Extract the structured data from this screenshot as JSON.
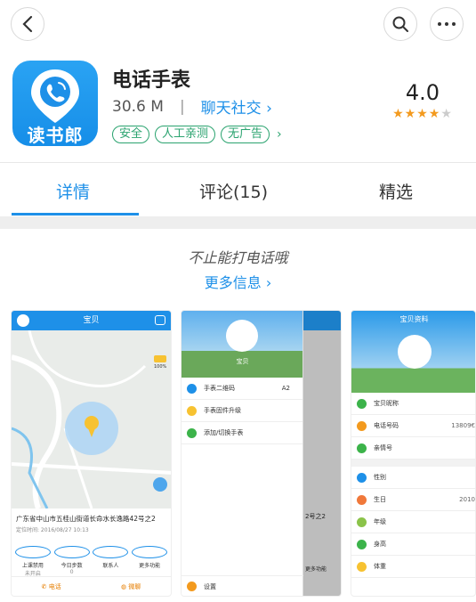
{
  "app": {
    "name": "电话手表",
    "size": "30.6 M",
    "separator": "|",
    "category": "聊天社交",
    "tags": [
      "安全",
      "人工亲测",
      "无广告"
    ],
    "rating": "4.0",
    "stars_filled": 4,
    "stars_total": 5,
    "icon_text": "读书郎"
  },
  "tabs": [
    {
      "label": "详情",
      "active": true
    },
    {
      "label": "评论(15)",
      "active": false
    },
    {
      "label": "精选",
      "active": false
    }
  ],
  "description": {
    "slogan": "不止能打电话哦",
    "more_info": "更多信息"
  },
  "screenshots": {
    "s1": {
      "title": "宝贝",
      "battery": "100%",
      "address": "广东省中山市五桂山街道长命水长逸路42号之2",
      "located": "定位时间: 2016/08/27 10:13",
      "actions": [
        {
          "label": "上课禁用",
          "sub": "未开启"
        },
        {
          "label": "今日步数",
          "sub": "0"
        },
        {
          "label": "联系人",
          "sub": ""
        },
        {
          "label": "更多功能",
          "sub": ""
        }
      ],
      "bottom": [
        "电话",
        "微聊"
      ]
    },
    "s2": {
      "avatar_label": "宝贝",
      "menu": [
        "手表二维码",
        "手表固件升级",
        "添加/切换手表"
      ],
      "menu_value": "A2",
      "bottom": "设置",
      "peek_text": "2号之2",
      "peek_more": "更多功能"
    },
    "s3": {
      "title": "宝贝资料",
      "rows": [
        "宝贝昵称",
        "电话号码",
        "亲情号",
        "性别",
        "生日",
        "年级",
        "身高",
        "体重"
      ],
      "phone_value": "13809€",
      "birthday_value": "2010"
    }
  },
  "colors": {
    "accent": "#1e90e8",
    "tag_green": "#2aa36f",
    "star": "#f39a1e"
  }
}
